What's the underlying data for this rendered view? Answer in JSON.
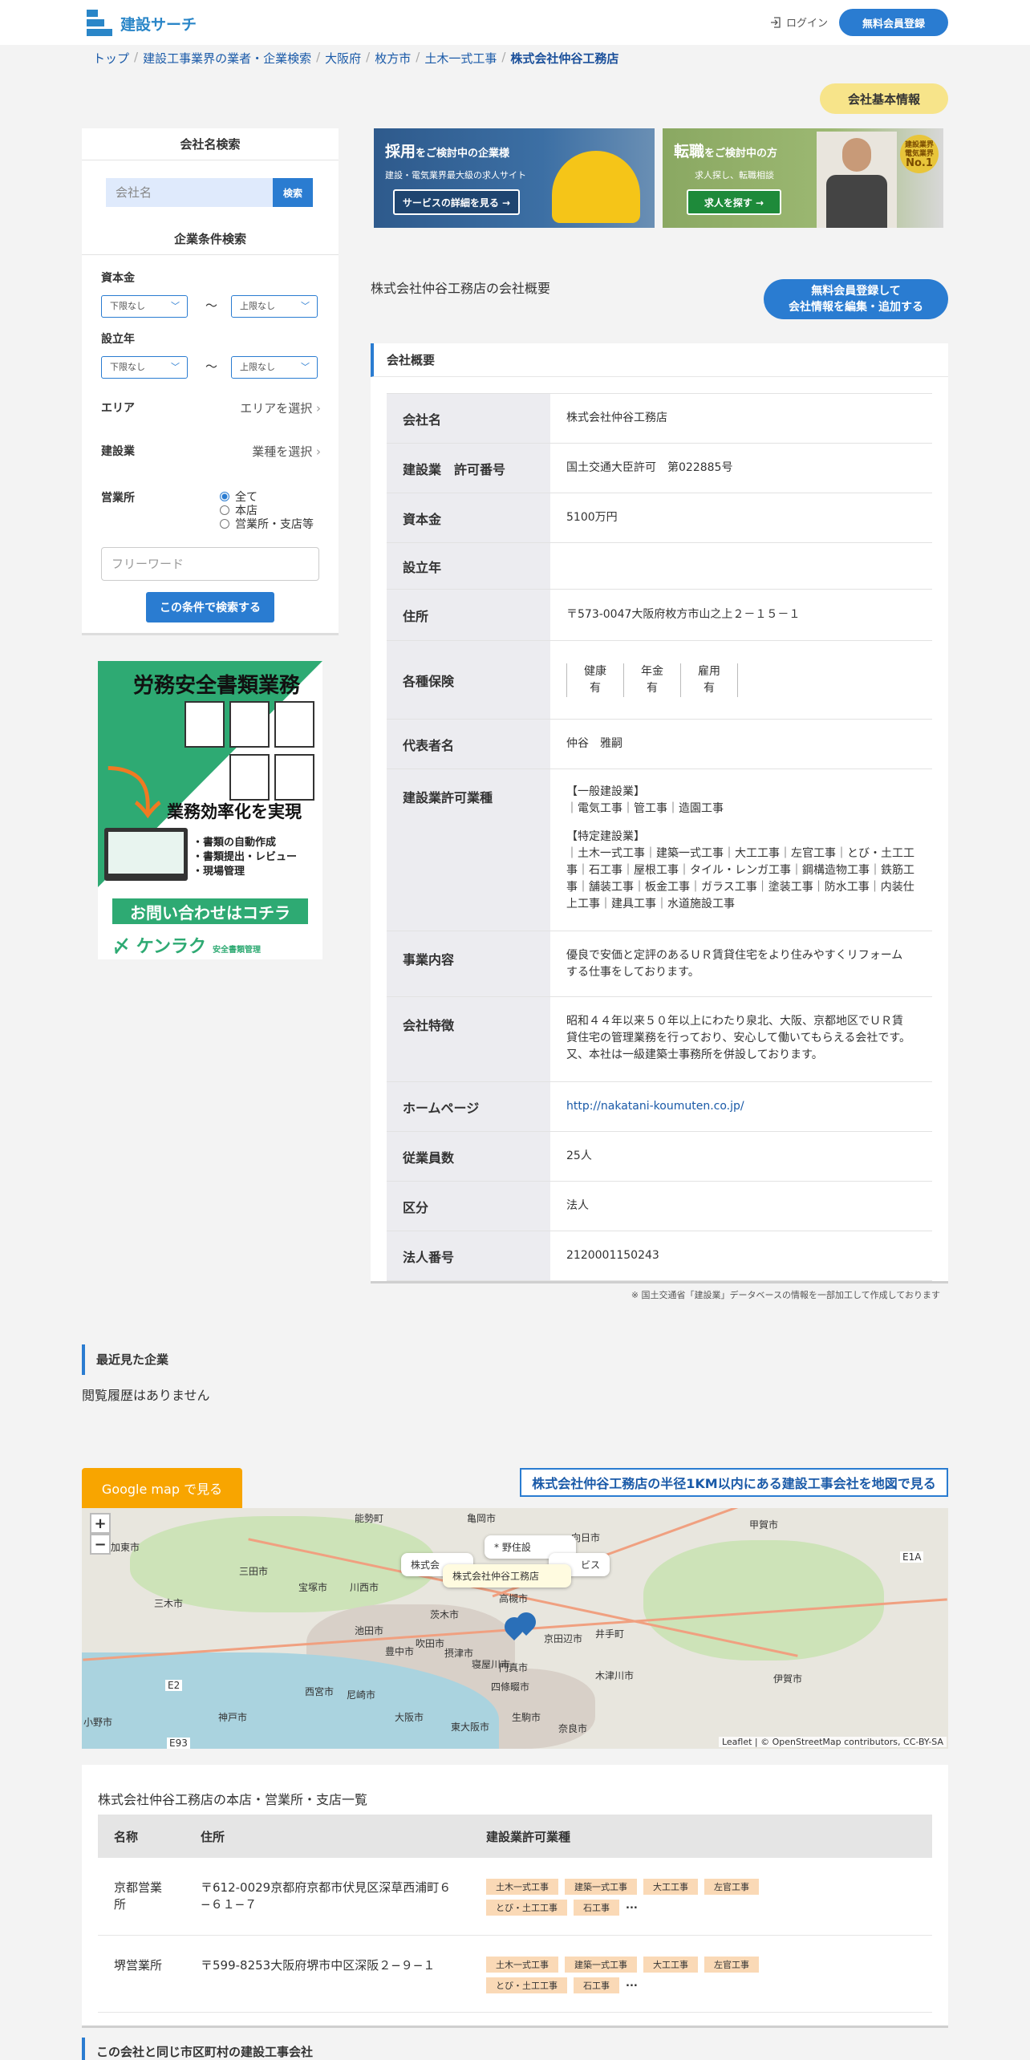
{
  "header": {
    "logo_text": "建設サーチ",
    "login_label": "ログイン",
    "register_label": "無料会員登録"
  },
  "breadcrumb": [
    "トップ",
    "建設工事業界の業者・企業検索",
    "大阪府",
    "枚方市",
    "土木一式工事",
    "株式会社仲谷工務店"
  ],
  "basic_info_badge": "会社基本情報",
  "sidebar": {
    "name_search_title": "会社名検索",
    "name_placeholder": "会社名",
    "search_btn": "検索",
    "condition_title": "企業条件検索",
    "capital_label": "資本金",
    "founded_label": "設立年",
    "lower_option": "下限なし",
    "upper_option": "上限なし",
    "tilde": "〜",
    "area_label": "エリア",
    "area_select": "エリアを選択",
    "industry_label": "建設業",
    "industry_select": "業種を選択",
    "office_label": "営業所",
    "office_options": [
      "全て",
      "本店",
      "営業所・支店等"
    ],
    "freeword_placeholder": "フリーワード",
    "condition_search_btn": "この条件で検索する"
  },
  "side_ad": {
    "title": "労務安全書類業務",
    "subtitle": "業務効率化を実現",
    "points": [
      "・書類の自動作成",
      "・書類提出・レビュー",
      "・現場管理"
    ],
    "contact": "お問い合わせはコチラ",
    "brand": "ケンラク",
    "brand_sub": "安全書類管理"
  },
  "banners": {
    "recruit_title": "採用",
    "recruit_title_rest": "をご検討中の企業様",
    "recruit_sub": "建設・電気業界最大級の求人サイト",
    "recruit_btn": "サービスの詳細を見る →",
    "job_title": "転職",
    "job_title_rest": "をご検討中の方",
    "job_sub": "求人探し、転職相談",
    "job_btn": "求人を探す →",
    "no1_top": "建設業界",
    "no1_mid": "電気業界",
    "no1_main": "No.1"
  },
  "overview": {
    "title": "株式会社仲谷工務店の会社概要",
    "edit_btn_line1": "無料会員登録して",
    "edit_btn_line2": "会社情報を編集・追加する",
    "card_title": "会社概要",
    "rows": {
      "company_name": {
        "label": "会社名",
        "value": "株式会社仲谷工務店"
      },
      "permit_number": {
        "label": "建設業　許可番号",
        "value": "国土交通大臣許可　第022885号"
      },
      "capital": {
        "label": "資本金",
        "value": "5100万円"
      },
      "founded": {
        "label": "設立年",
        "value": ""
      },
      "address": {
        "label": "住所",
        "value": "〒573-0047大阪府枚方市山之上２－１５－１"
      },
      "insurance": {
        "label": "各種保険",
        "items": [
          {
            "name": "健康",
            "status": "有"
          },
          {
            "name": "年金",
            "status": "有"
          },
          {
            "name": "雇用",
            "status": "有"
          }
        ]
      },
      "representative": {
        "label": "代表者名",
        "value": "仲谷　雅嗣"
      },
      "permit_types": {
        "label": "建設業許可業種",
        "general_head": "【一般建設業】",
        "general": "｜電気工事｜管工事｜造園工事",
        "special_head": "【特定建設業】",
        "special": "｜土木一式工事｜建築一式工事｜大工工事｜左官工事｜とび・土工工事｜石工事｜屋根工事｜タイル・レンガ工事｜鋼構造物工事｜鉄筋工事｜舗装工事｜板金工事｜ガラス工事｜塗装工事｜防水工事｜内装仕上工事｜建具工事｜水道施設工事"
      },
      "business": {
        "label": "事業内容",
        "value": "優良で安価と定評のあるＵＲ賃貸住宅をより住みやすくリフォーム する仕事をしております。"
      },
      "features": {
        "label": "会社特徴",
        "value": "昭和４４年以来５０年以上にわたり泉北、大阪、京都地区でＵＲ賃 貸住宅の管理業務を行っており、安心して働いてもらえる会社です。又、本社は一級建築士事務所を併設しております。"
      },
      "homepage": {
        "label": "ホームページ",
        "value": "http://nakatani-koumuten.co.jp/"
      },
      "employees": {
        "label": "従業員数",
        "value": "25人"
      },
      "category": {
        "label": "区分",
        "value": "法人"
      },
      "corporate_number": {
        "label": "法人番号",
        "value": "2120001150243"
      }
    },
    "note": "※ 国土交通省「建設業」データベースの情報を一部加工して作成しております"
  },
  "recent": {
    "title": "最近見た企業",
    "empty": "閲覧履歴はありません"
  },
  "map": {
    "gmap_btn": "Google map で見る",
    "radius_link": "株式会社仲谷工務店の半径1KM以内にある建設工事会社を地図で見る",
    "zoom_in": "+",
    "zoom_out": "−",
    "popup_main": "株式会社仲谷工務店",
    "popup_a": "* 野住設",
    "popup_b": "株式会",
    "popup_c": "ビス",
    "attribution": "Leaflet | © OpenStreetMap contributors, CC-BY-SA",
    "labels": [
      "能勢町",
      "亀岡市",
      "向日市",
      "甲賀市",
      "加東市",
      "三田市",
      "宝塚市",
      "川西市",
      "茨木市",
      "高槻市",
      "三木市",
      "池田市",
      "豊中市",
      "吹田市",
      "摂津市",
      "門真市",
      "京田辺市",
      "井手町",
      "伊賀市",
      "西宮市",
      "尼崎市",
      "寝屋川市",
      "四條畷市",
      "木津川市",
      "神戸市",
      "大阪市",
      "東大阪市",
      "生駒市",
      "奈良市",
      "小野市",
      "E1A",
      "E2",
      "E93"
    ]
  },
  "branches": {
    "title": "株式会社仲谷工務店の本店・営業所・支店一覧",
    "columns": [
      "名称",
      "住所",
      "建設業許可業種"
    ],
    "rows": [
      {
        "name": "京都営業所",
        "address": "〒612-0029京都府京都市伏見区深草西浦町６−６１−７",
        "tags": [
          "土木一式工事",
          "建築一式工事",
          "大工工事",
          "左官工事",
          "とび・土工工事",
          "石工事"
        ],
        "more": "..."
      },
      {
        "name": "堺営業所",
        "address": "〒599-8253大阪府堺市中区深阪２−９−１",
        "tags": [
          "土木一式工事",
          "建築一式工事",
          "大工工事",
          "左官工事",
          "とび・土工工事",
          "石工事"
        ],
        "more": "..."
      }
    ]
  },
  "same_city_title": "この会社と同じ市区町村の建設工事会社",
  "colors": {
    "accent": "#2a7cd1",
    "badge": "#f7e48a",
    "map_btn": "#f8a500",
    "tag": "#fad9b6"
  }
}
